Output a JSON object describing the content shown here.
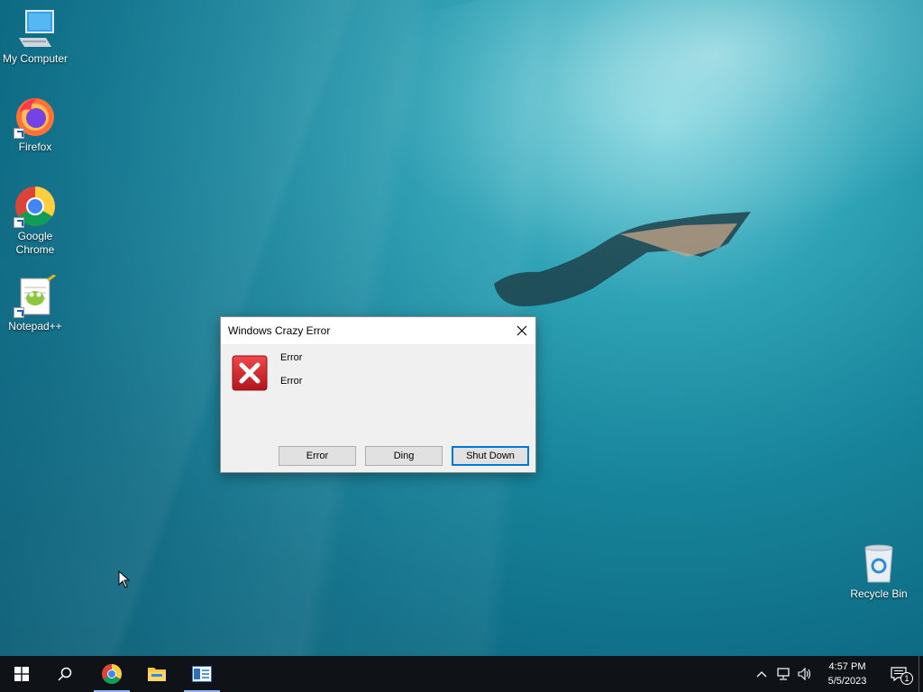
{
  "desktop": {
    "icons": [
      {
        "label": "My Computer"
      },
      {
        "label": "Firefox"
      },
      {
        "label": "Google Chrome"
      },
      {
        "label": "Notepad++"
      },
      {
        "label": "Recycle Bin"
      }
    ]
  },
  "dialog": {
    "title": "Windows Crazy Error",
    "messages": [
      "Error",
      "Error"
    ],
    "buttons": [
      {
        "label": "Error"
      },
      {
        "label": "Ding"
      },
      {
        "label": "Shut Down"
      }
    ],
    "icon": "error-x-icon"
  },
  "taskbar": {
    "items": [
      "start-icon",
      "search-icon",
      "chrome-icon",
      "file-explorer-icon",
      "app-window-icon"
    ],
    "tray": {
      "time": "4:57 PM",
      "date": "5/5/2023",
      "notification_count": "1"
    }
  }
}
